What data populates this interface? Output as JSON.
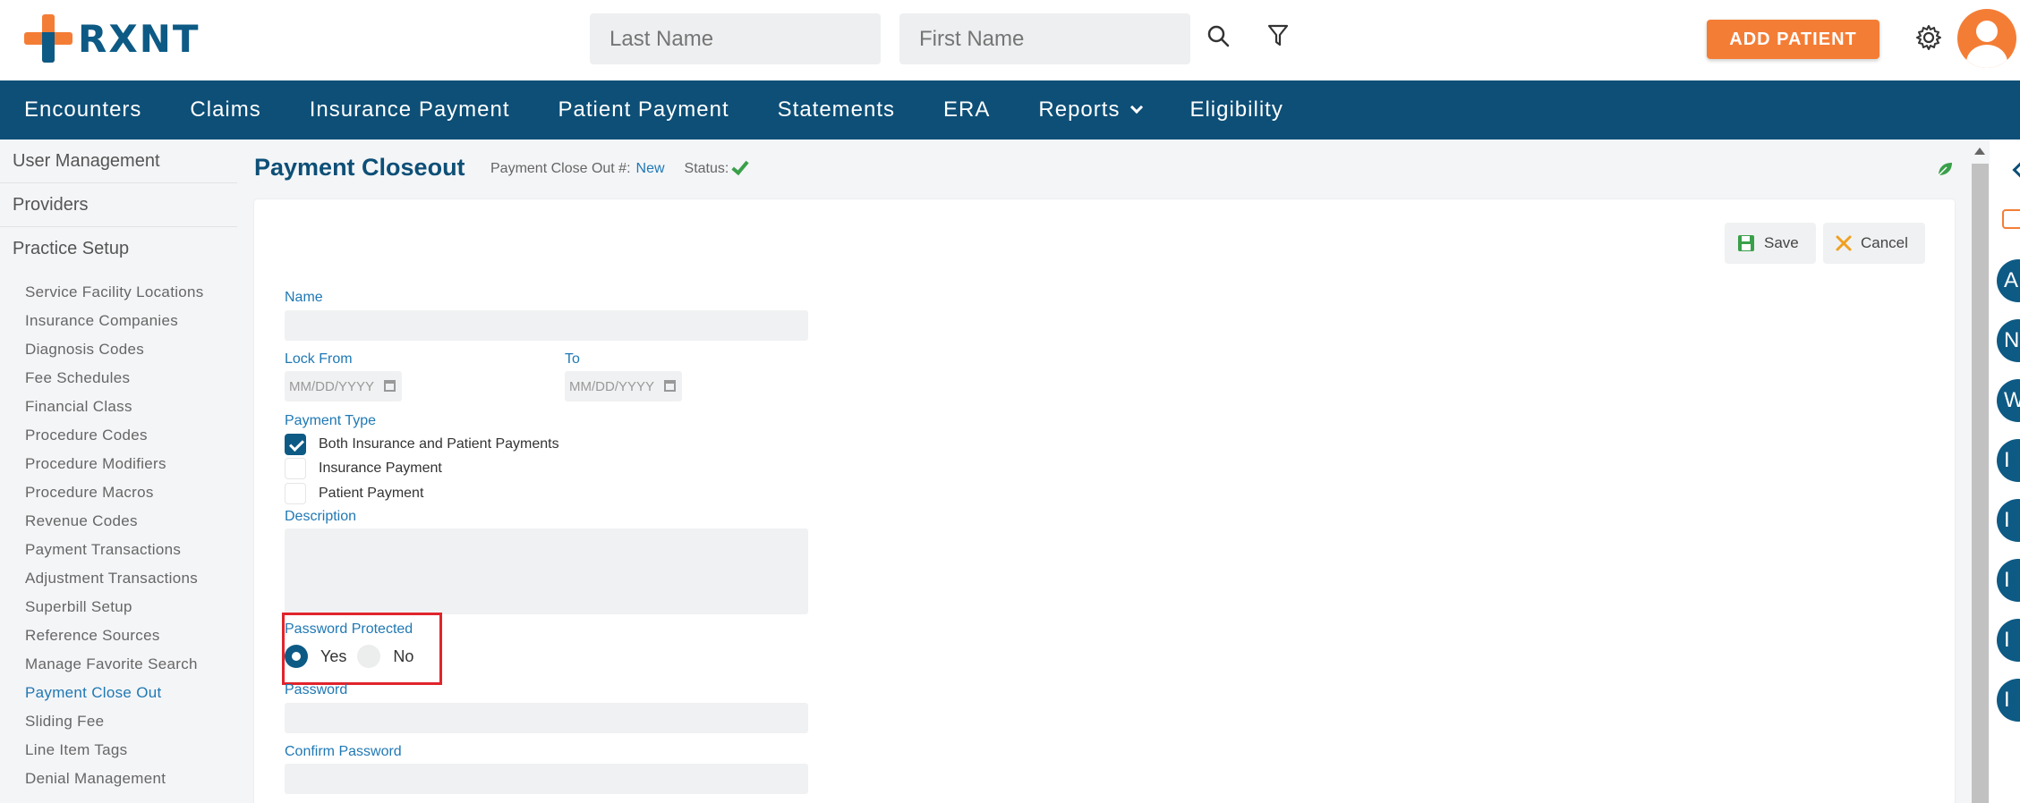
{
  "header": {
    "logo_text": "RXNT",
    "last_name_placeholder": "Last Name",
    "first_name_placeholder": "First Name",
    "add_patient_label": "ADD PATIENT"
  },
  "nav": {
    "items": [
      "Encounters",
      "Claims",
      "Insurance Payment",
      "Patient Payment",
      "Statements",
      "ERA",
      "Reports",
      "Eligibility"
    ]
  },
  "sidebar": {
    "headings": [
      "User Management",
      "Providers",
      "Practice Setup"
    ],
    "items": [
      "Service Facility Locations",
      "Insurance Companies",
      "Diagnosis Codes",
      "Fee Schedules",
      "Financial Class",
      "Procedure Codes",
      "Procedure Modifiers",
      "Procedure Macros",
      "Revenue Codes",
      "Payment Transactions",
      "Adjustment Transactions",
      "Superbill Setup",
      "Reference Sources",
      "Manage Favorite Search",
      "Payment Close Out",
      "Sliding Fee",
      "Line Item Tags",
      "Denial Management"
    ],
    "active_item": "Payment Close Out"
  },
  "page": {
    "title": "Payment Closeout",
    "closeout_label": "Payment Close Out #:",
    "closeout_value": "New",
    "status_label": "Status:"
  },
  "toolbar": {
    "save_label": "Save",
    "cancel_label": "Cancel"
  },
  "form": {
    "name_label": "Name",
    "name_value": "",
    "lock_from_label": "Lock From",
    "to_label": "To",
    "date_placeholder": "MM/DD/YYYY",
    "payment_type_label": "Payment Type",
    "payment_types": [
      {
        "label": "Both Insurance and Patient Payments",
        "checked": true
      },
      {
        "label": "Insurance Payment",
        "checked": false
      },
      {
        "label": "Patient Payment",
        "checked": false
      }
    ],
    "description_label": "Description",
    "password_protected_label": "Password Protected",
    "yes_label": "Yes",
    "no_label": "No",
    "password_protected_value": "Yes",
    "password_label": "Password",
    "confirm_password_label": "Confirm Password"
  },
  "rail": {
    "letters": [
      "A",
      "N",
      "W",
      "I",
      "I",
      "I",
      "I",
      "I"
    ]
  },
  "colors": {
    "brand_blue": "#0d4f77",
    "accent_orange": "#f47d36",
    "link_blue": "#1f78b4",
    "success_green": "#3aa04a",
    "highlight_red": "#e0242b"
  }
}
